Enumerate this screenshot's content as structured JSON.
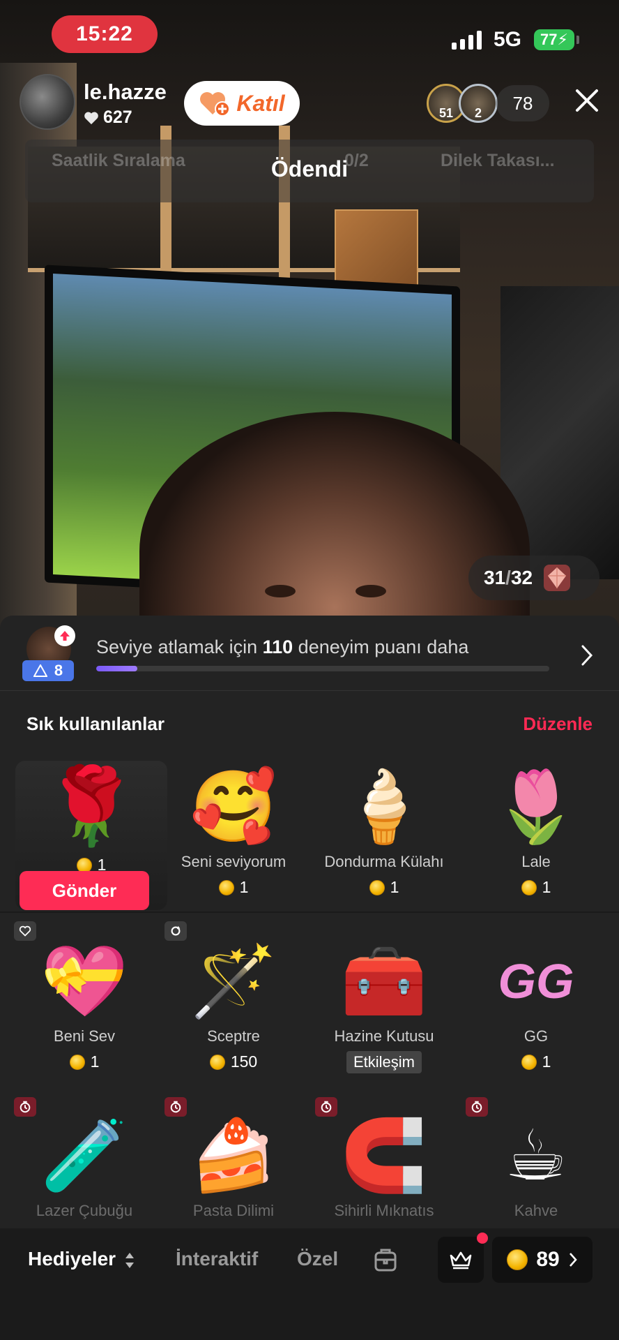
{
  "status_bar": {
    "time": "15:22",
    "network": "5G",
    "battery": "77"
  },
  "host": {
    "name": "le.hazze",
    "likes": "627",
    "join_label": "Katıl"
  },
  "viewers": {
    "top_ranks": [
      "51",
      "2"
    ],
    "count": "78"
  },
  "banner": {
    "left_ghost": "Saatlik Sıralama",
    "mid_ghost": "0/2",
    "right_ghost": "Dilek Takası...",
    "text": "Ödendi"
  },
  "gem_counter": {
    "current": "31",
    "total": "32"
  },
  "level": {
    "badge": "8",
    "text_prefix": "Seviye atlamak için ",
    "points": "110",
    "text_suffix": " deneyim puanı daha",
    "progress": 0.09
  },
  "frequent": {
    "title": "Sık kullanılanlar",
    "edit": "Düzenle",
    "send_label": "Gönder",
    "items": [
      {
        "emoji": "🌹",
        "name": "",
        "price": "1",
        "icon": "rose-icon"
      },
      {
        "emoji": "🥰",
        "name": "Seni seviyorum",
        "price": "1",
        "icon": "hug-heart-icon"
      },
      {
        "emoji": "🍦",
        "name": "Dondurma Külahı",
        "price": "1",
        "icon": "ice-cream-icon"
      },
      {
        "emoji": "🌷",
        "name": "Lale",
        "price": "1",
        "icon": "tulip-icon"
      }
    ]
  },
  "gifts_row2": [
    {
      "emoji": "💝",
      "name": "Beni Sev",
      "price": "1",
      "icon": "love-heart-icon"
    },
    {
      "emoji": "🪄",
      "name": "Sceptre",
      "price": "150",
      "icon": "sceptre-icon"
    },
    {
      "emoji": "🧰",
      "name": "Hazine Kutusu",
      "badge": "Etkileşim",
      "icon": "treasure-chest-icon"
    },
    {
      "emoji": "🎮",
      "name": "GG",
      "price": "1",
      "icon": "gg-icon"
    }
  ],
  "gifts_row3": [
    {
      "emoji": "🧪",
      "name": "Lazer Çubuğu",
      "icon": "laser-stick-icon"
    },
    {
      "emoji": "🍰",
      "name": "Pasta Dilimi",
      "icon": "cake-slice-icon"
    },
    {
      "emoji": "🧲",
      "name": "Sihirli Mıknatıs",
      "icon": "magnet-icon"
    },
    {
      "emoji": "☕",
      "name": "Kahve",
      "icon": "coffee-cup-icon"
    }
  ],
  "tabs": {
    "gifts": "Hediyeler",
    "interactive": "İnteraktif",
    "special": "Özel"
  },
  "wallet": {
    "coins": "89"
  },
  "colors": {
    "accent": "#fe2c55",
    "join": "#f2672a",
    "level_badge": "#4a76e8",
    "time_pill": "#e0343f"
  }
}
